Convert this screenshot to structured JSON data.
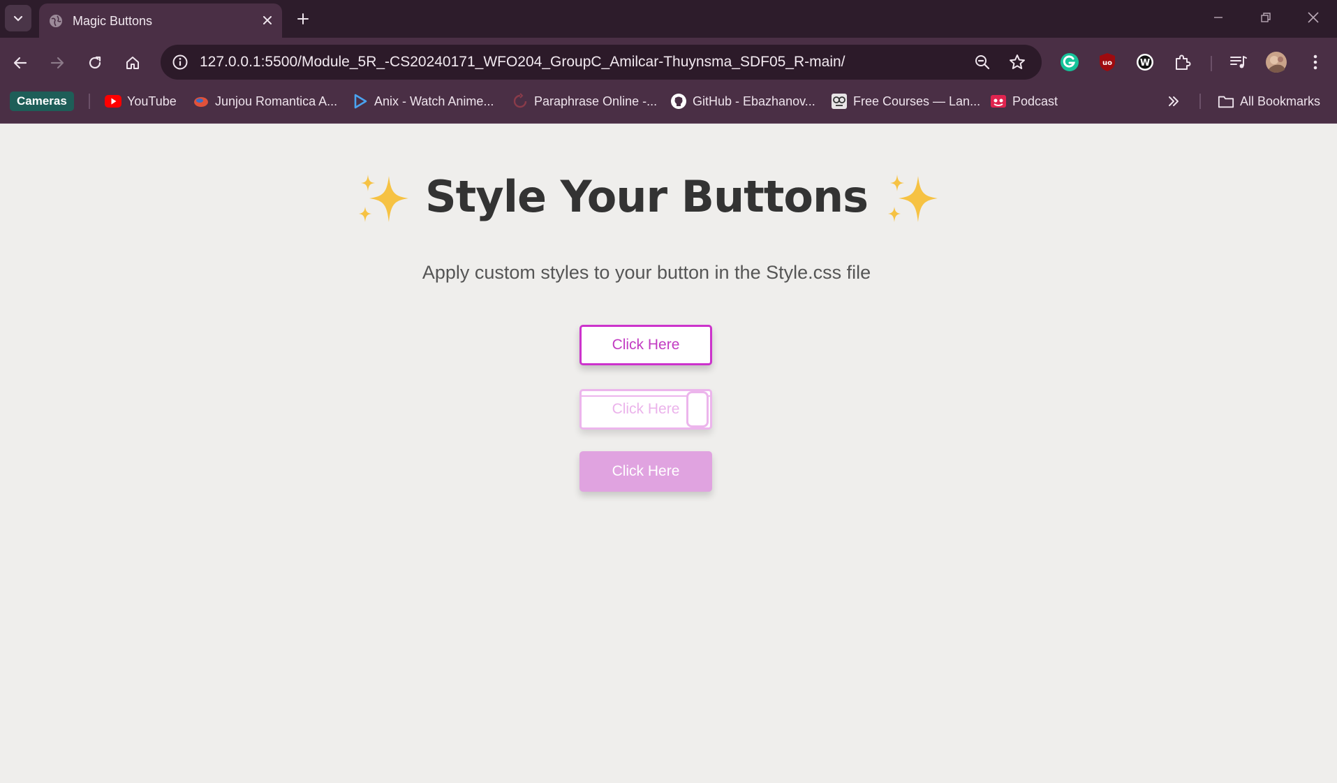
{
  "browser": {
    "tab": {
      "title": "Magic Buttons"
    },
    "url": "127.0.0.1:5500/Module_5R_-CS20240171_WFO204_GroupC_Amilcar-Thuynsma_SDF05_R-main/",
    "bookmarks": [
      {
        "label": "Cameras",
        "icon": "chip"
      },
      {
        "label": "YouTube",
        "icon": "youtube-icon"
      },
      {
        "label": "Junjou Romantica A...",
        "icon": "anime-icon"
      },
      {
        "label": "Anix - Watch Anime...",
        "icon": "anix-icon"
      },
      {
        "label": "Paraphrase Online -...",
        "icon": "paraphrase-icon"
      },
      {
        "label": "GitHub - Ebazhanov...",
        "icon": "github-icon"
      },
      {
        "label": "Free Courses — Lan...",
        "icon": "courses-icon"
      },
      {
        "label": "Podcast",
        "icon": "podcast-icon"
      }
    ],
    "all_bookmarks_label": "All Bookmarks",
    "colors": {
      "frame": "#2d1c2b",
      "toolbar": "#4a2f45",
      "omnibox": "#2c1a29"
    }
  },
  "page": {
    "heading": "Style Your Buttons",
    "subtitle": "Apply custom styles to your button in the Style.css file",
    "buttons": [
      {
        "label": "Click Here",
        "style": "outlined-magenta"
      },
      {
        "label": "Click Here",
        "style": "outlined-light-pink"
      },
      {
        "label": "Click Here",
        "style": "filled-pink"
      }
    ],
    "colors": {
      "background": "#efeeec",
      "accent": "#cc33cc",
      "soft": "#e0a3e0"
    }
  }
}
